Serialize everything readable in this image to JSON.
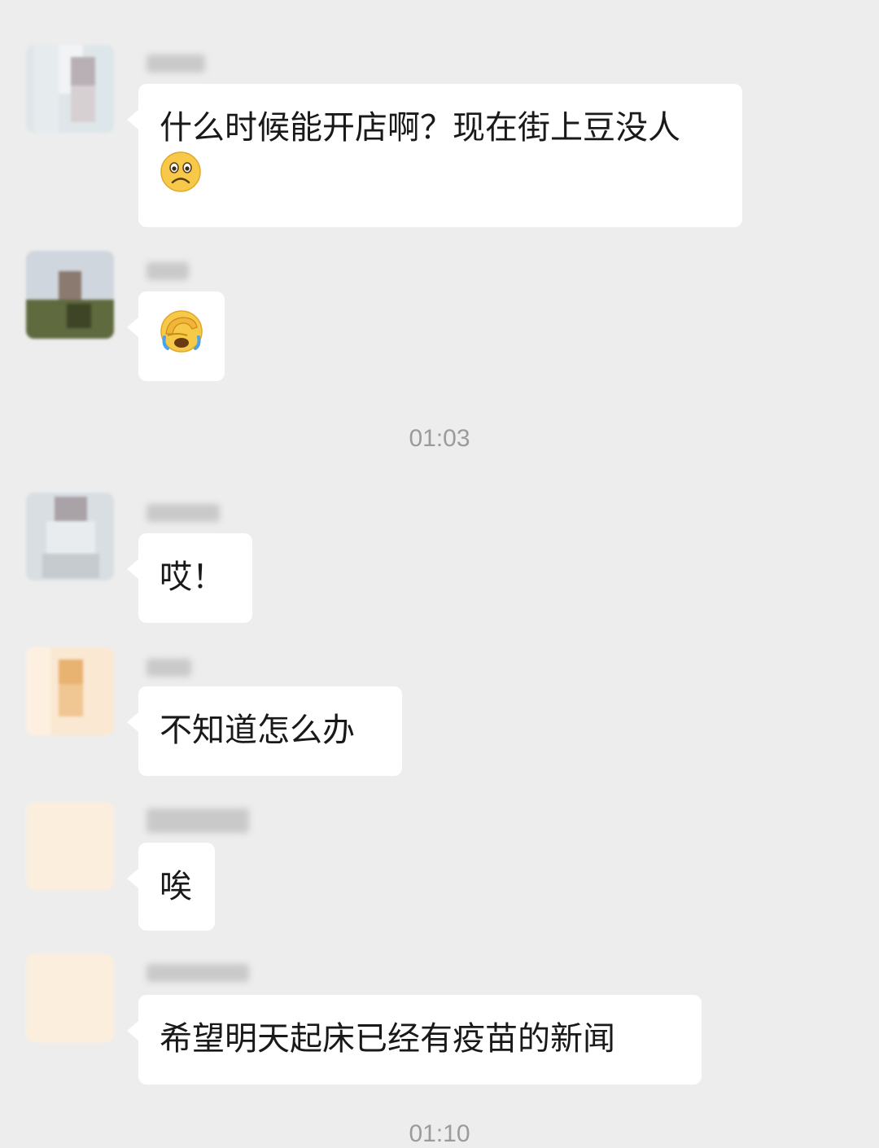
{
  "messages": [
    {
      "sender": "Dc2d",
      "text": "什么时候能开店啊？现在街上豆没人",
      "emoji": "slightly-frowning-face"
    },
    {
      "sender": "",
      "text": "",
      "emoji": "face-palm-crying"
    },
    {
      "sender": "",
      "text": "哎！"
    },
    {
      "sender": "",
      "text": "不知道怎么办"
    },
    {
      "sender": "",
      "text": "唉"
    },
    {
      "sender": "",
      "text": "希望明天起床已经有疫苗的新闻"
    }
  ],
  "timestamps": [
    "01:03",
    "01:10"
  ],
  "colors": {
    "background": "#ededed",
    "bubble": "#ffffff",
    "text": "#191919",
    "timestamp": "#9b9b9b"
  }
}
